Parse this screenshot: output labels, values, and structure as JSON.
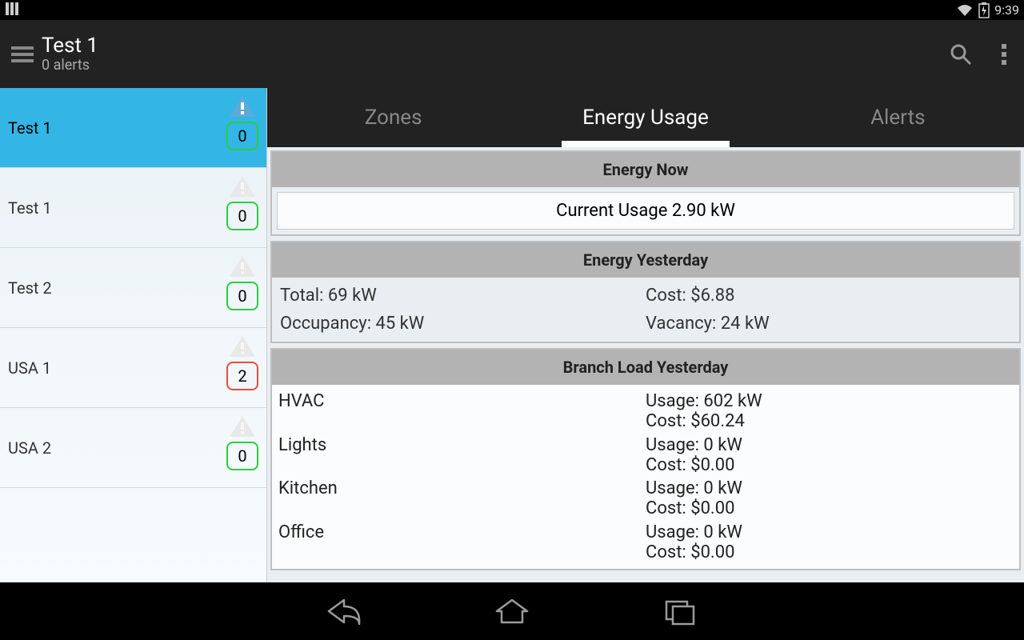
{
  "status": {
    "time": "9:39"
  },
  "header": {
    "title": "Test 1",
    "subtitle": "0 alerts"
  },
  "sidebar": {
    "items": [
      {
        "label": "Test 1",
        "count": "0",
        "warn": false,
        "selected": true,
        "iconActive": true
      },
      {
        "label": "Test 1",
        "count": "0",
        "warn": false,
        "selected": false,
        "iconActive": false
      },
      {
        "label": "Test 2",
        "count": "0",
        "warn": false,
        "selected": false,
        "iconActive": false
      },
      {
        "label": "USA 1",
        "count": "2",
        "warn": true,
        "selected": false,
        "iconActive": false
      },
      {
        "label": "USA 2",
        "count": "0",
        "warn": false,
        "selected": false,
        "iconActive": false
      }
    ]
  },
  "tabs": [
    {
      "label": "Zones",
      "active": false
    },
    {
      "label": "Energy Usage",
      "active": true
    },
    {
      "label": "Alerts",
      "active": false
    }
  ],
  "energyNow": {
    "heading": "Energy Now",
    "currentLabel": "Current Usage 2.90 kW"
  },
  "energyYesterday": {
    "heading": "Energy Yesterday",
    "total": "Total: 69 kW",
    "cost": "Cost: $6.88",
    "occupancy": "Occupancy: 45 kW",
    "vacancy": "Vacancy: 24 kW"
  },
  "branchLoad": {
    "heading": "Branch Load Yesterday",
    "rows": [
      {
        "name": "HVAC",
        "usage": "Usage: 602 kW",
        "cost": "Cost: $60.24"
      },
      {
        "name": "Lights",
        "usage": "Usage: 0 kW",
        "cost": "Cost: $0.00"
      },
      {
        "name": "Kitchen",
        "usage": "Usage: 0 kW",
        "cost": "Cost: $0.00"
      },
      {
        "name": "Office",
        "usage": "Usage: 0 kW",
        "cost": "Cost: $0.00"
      }
    ]
  }
}
